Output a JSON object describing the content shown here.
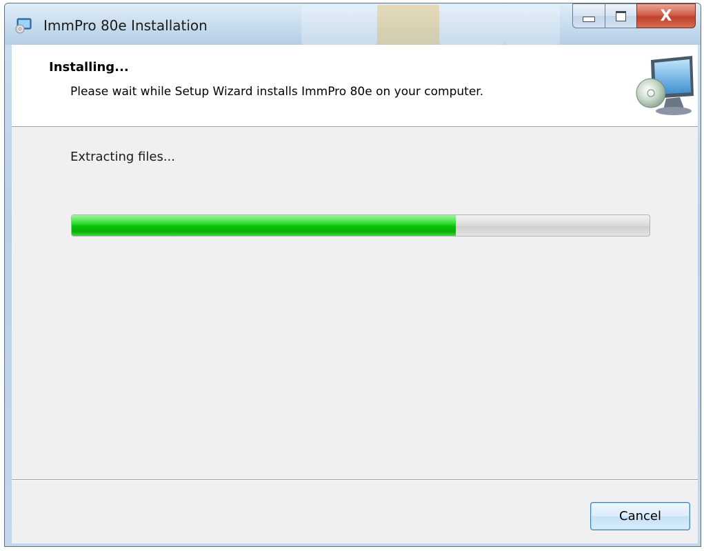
{
  "window": {
    "title": "ImmPro 80e Installation",
    "app_icon": "installer-icon",
    "caption_buttons": {
      "minimize_icon": "minimize-icon",
      "maximize_icon": "maximize-icon",
      "close_glyph": "X"
    }
  },
  "header": {
    "title": "Installing...",
    "subtitle": "Please wait while Setup Wizard installs ImmPro 80e on your computer.",
    "icon": "computer-cd-icon"
  },
  "main": {
    "status": "Extracting files...",
    "progress_fraction": 0.665,
    "progress_color": "#06c006"
  },
  "footer": {
    "cancel_label": "Cancel"
  },
  "colors": {
    "close_button": "#c0412b",
    "content_bg": "#f0f0f0",
    "button_border": "#3c7fb1"
  }
}
